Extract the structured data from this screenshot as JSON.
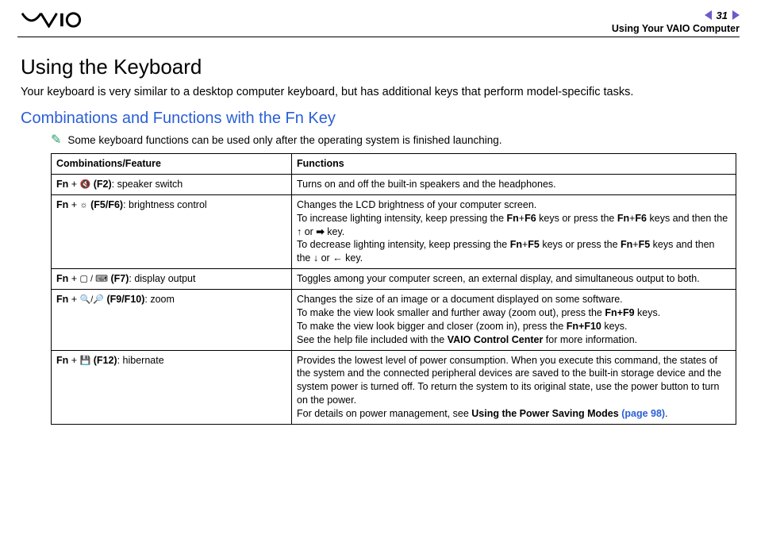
{
  "header": {
    "page_number": "31",
    "section": "Using Your VAIO Computer"
  },
  "title": "Using the Keyboard",
  "intro": "Your keyboard is very similar to a desktop computer keyboard, but has additional keys that perform model-specific tasks.",
  "subtitle": "Combinations and Functions with the Fn Key",
  "note": "Some keyboard functions can be used only after the operating system is finished launching.",
  "table": {
    "head": {
      "c1": "Combinations/Feature",
      "c2": "Functions"
    },
    "rows": [
      {
        "fn": "Fn",
        "key": " (F2)",
        "label": ": speaker switch",
        "icon": "🔇",
        "func_html": "Turns on and off the built-in speakers and the headphones."
      },
      {
        "fn": "Fn",
        "key": " (F5/F6)",
        "label": ": brightness control",
        "icon": "☼",
        "func_html": "Changes the LCD brightness of your computer screen.<br>To increase lighting intensity, keep pressing the <span class='b'>Fn</span>+<span class='b'>F6</span> keys or press the <span class='b'>Fn</span>+<span class='b'>F6</span> keys and then the <span class='arrow'>↑</span> or <span class='arrow'>➡</span> key.<br>To decrease lighting intensity, keep pressing the <span class='b'>Fn</span>+<span class='b'>F5</span> keys or press the <span class='b'>Fn</span>+<span class='b'>F5</span> keys and then the <span class='arrow'>↓</span> or <span class='arrow'>←</span> key."
      },
      {
        "fn": "Fn",
        "key": " (F7)",
        "label": ": display output",
        "icon": "▢ / ⌨",
        "func_html": "Toggles among your computer screen, an external display, and simultaneous output to both."
      },
      {
        "fn": "Fn",
        "key": " (F9/F10)",
        "label": ": zoom",
        "icon": "🔍/🔎",
        "func_html": "Changes the size of an image or a document displayed on some software.<br>To make the view look smaller and further away (zoom out), press the <span class='b'>Fn+F9</span> keys.<br>To make the view look bigger and closer (zoom in), press the <span class='b'>Fn+F10</span> keys.<br>See the help file included with the <span class='b'>VAIO Control Center</span> for more information."
      },
      {
        "fn": "Fn",
        "key": " (F12)",
        "label": ": hibernate",
        "icon": "💾",
        "func_html": "Provides the lowest level of power consumption. When you execute this command, the states of the system and the connected peripheral devices are saved to the built-in storage device and the system power is turned off. To return the system to its original state, use the power button to turn on the power.<br>For details on power management, see <span class='b'>Using the Power Saving Modes <span class='lk'>(page 98)</span></span>."
      }
    ]
  }
}
